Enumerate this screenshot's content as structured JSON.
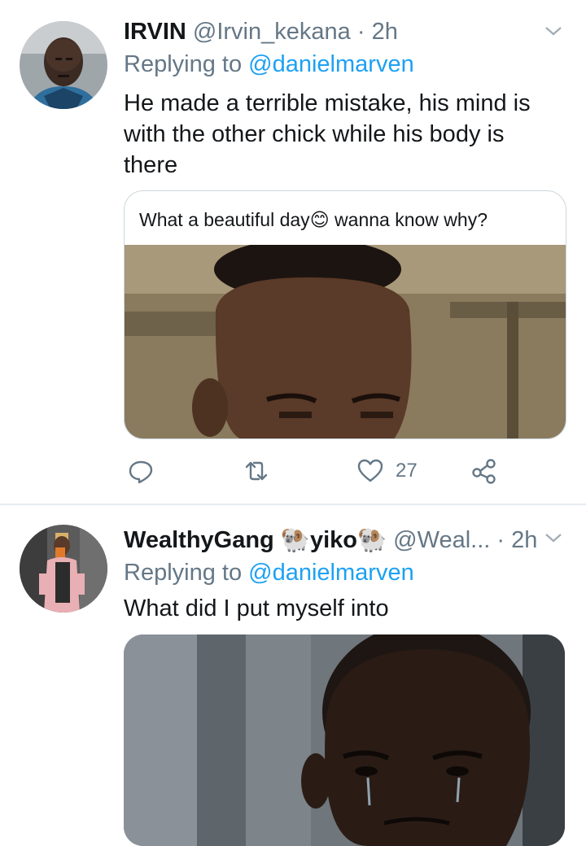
{
  "tweets": [
    {
      "name": "IRVIN",
      "handle": "@Irvin_kekana",
      "separator": "·",
      "time": "2h",
      "replying_prefix": "Replying to",
      "replying_to": "@danielmarven",
      "text": "He made a terrible mistake, his mind is with the other chick while his body is there",
      "card_caption_before_emoji": "What a beautiful day",
      "card_caption_emoji": "😊",
      "card_caption_after_emoji": " wanna know why?",
      "likes": "27"
    },
    {
      "name": "WealthyGang",
      "name_emoji_1": "🐏",
      "name_mid": "yiko",
      "name_emoji_2": "🐏",
      "handle": "@Weal...",
      "separator": "·",
      "time": "2h",
      "replying_prefix": "Replying to",
      "replying_to": "@danielmarven",
      "text": "What did I put myself into"
    }
  ],
  "icons": [
    "chevron-down-icon",
    "reply-icon",
    "retweet-icon",
    "heart-icon",
    "share-icon"
  ],
  "colors": {
    "link": "#1da1f2",
    "muted": "#657786",
    "text": "#14171a",
    "divider": "#e6ecf0"
  }
}
